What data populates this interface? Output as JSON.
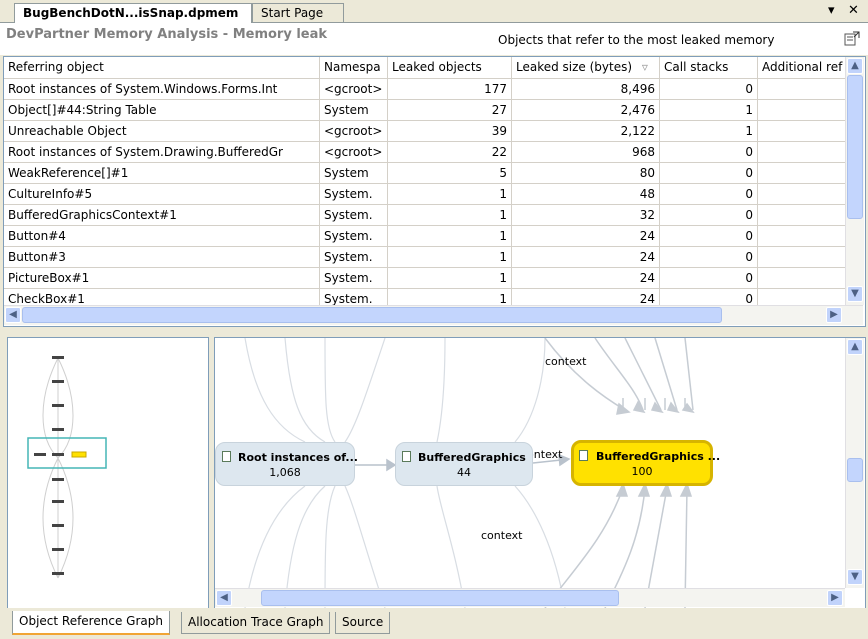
{
  "document_tabs": [
    {
      "label": "BugBenchDotN...isSnap.dpmem",
      "active": true
    },
    {
      "label": "Start Page",
      "active": false
    }
  ],
  "window_controls": {
    "dropdown_icon": "chevron-down-icon",
    "close_label": "✕"
  },
  "header": {
    "title": "DevPartner Memory Analysis - Memory leak",
    "subtitle": "Objects that refer to the most leaked memory"
  },
  "grid": {
    "columns": [
      "Referring object",
      "Namespa",
      "Leaked objects",
      "Leaked size (bytes)",
      "Call stacks",
      "Additional ref"
    ],
    "sort_indicator": "▿",
    "rows": [
      [
        "Root instances of System.Windows.Forms.Int",
        "<gcroot>",
        "177",
        "8,496",
        "0",
        ""
      ],
      [
        "Object[]#44:String Table",
        "System",
        "27",
        "2,476",
        "1",
        ""
      ],
      [
        "Unreachable Object",
        "<gcroot>",
        "39",
        "2,122",
        "1",
        ""
      ],
      [
        "Root instances of System.Drawing.BufferedGr",
        "<gcroot>",
        "22",
        "968",
        "0",
        ""
      ],
      [
        "WeakReference[]#1",
        "System",
        "5",
        "80",
        "0",
        ""
      ],
      [
        "CultureInfo#5",
        "System.",
        "1",
        "48",
        "0",
        ""
      ],
      [
        "BufferedGraphicsContext#1",
        "System.",
        "1",
        "32",
        "0",
        ""
      ],
      [
        "Button#4",
        "System.",
        "1",
        "24",
        "0",
        ""
      ],
      [
        "Button#3",
        "System.",
        "1",
        "24",
        "0",
        ""
      ],
      [
        "PictureBox#1",
        "System.",
        "1",
        "24",
        "0",
        ""
      ],
      [
        "CheckBox#1",
        "System.",
        "1",
        "24",
        "0",
        ""
      ]
    ]
  },
  "graph": {
    "nodes": [
      {
        "title": "Root instances of...",
        "value": "1,068",
        "highlight": false
      },
      {
        "title": "BufferedGraphics",
        "value": "44",
        "highlight": false
      },
      {
        "title": "BufferedGraphics ...",
        "value": "100",
        "highlight": true
      }
    ],
    "edge_labels": [
      "context",
      "context",
      "context"
    ]
  },
  "bottom_tabs": [
    {
      "label": "Object Reference Graph",
      "active": true
    },
    {
      "label": "Allocation Trace Graph",
      "active": false
    },
    {
      "label": "Source",
      "active": false
    }
  ],
  "colors": {
    "highlight_node": "#ffe100",
    "highlight_border": "#d6b400",
    "node_fill": "#dde7ef",
    "overview_box": "#45b5b5"
  }
}
